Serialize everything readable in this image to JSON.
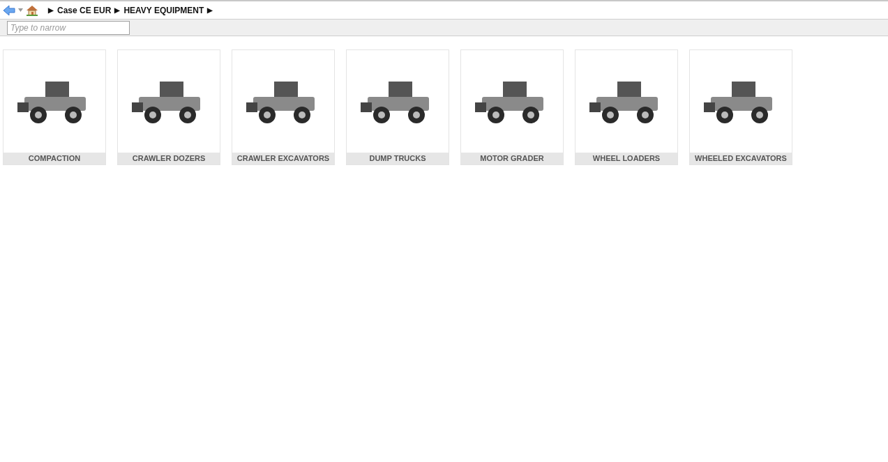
{
  "breadcrumb": [
    {
      "kind": "separator",
      "text": "▶"
    },
    {
      "kind": "link",
      "text": "Case CE EUR"
    },
    {
      "kind": "separator",
      "text": "▶"
    },
    {
      "kind": "link",
      "text": "HEAVY EQUIPMENT"
    },
    {
      "kind": "separator",
      "text": "▶"
    }
  ],
  "filter": {
    "placeholder": "Type to narrow"
  },
  "categories": [
    {
      "label": "COMPACTION"
    },
    {
      "label": "CRAWLER DOZERS"
    },
    {
      "label": "CRAWLER EXCAVATORS"
    },
    {
      "label": "DUMP TRUCKS"
    },
    {
      "label": "MOTOR GRADER"
    },
    {
      "label": "WHEEL LOADERS"
    },
    {
      "label": "WHEELED EXCAVATORS"
    }
  ]
}
